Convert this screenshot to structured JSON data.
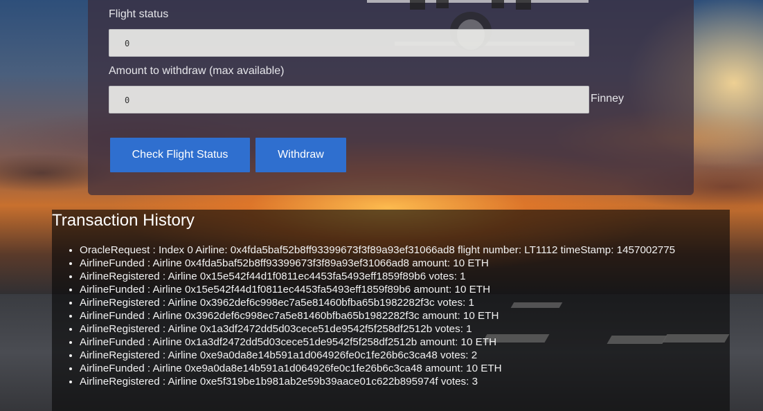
{
  "form": {
    "flight_status_label": "Flight status",
    "flight_status_value": "0",
    "withdraw_label": "Amount to withdraw (max available)",
    "withdraw_value": "0",
    "withdraw_unit": "Finney",
    "check_button_label": "Check Flight Status",
    "withdraw_button_label": "Withdraw"
  },
  "history": {
    "title": "Transaction History",
    "items": [
      "OracleRequest : Index 0 Airline: 0x4fda5baf52b8ff93399673f3f89a93ef31066ad8 flight number: LT1112 timeStamp: 1457002775",
      "AirlineFunded : Airline 0x4fda5baf52b8ff93399673f3f89a93ef31066ad8 amount: 10 ETH",
      "AirlineRegistered : Airline 0x15e542f44d1f0811ec4453fa5493eff1859f89b6 votes: 1",
      "AirlineFunded : Airline 0x15e542f44d1f0811ec4453fa5493eff1859f89b6 amount: 10 ETH",
      "AirlineRegistered : Airline 0x3962def6c998ec7a5e81460bfba65b1982282f3c votes: 1",
      "AirlineFunded : Airline 0x3962def6c998ec7a5e81460bfba65b1982282f3c amount: 10 ETH",
      "AirlineRegistered : Airline 0x1a3df2472dd5d03cece51de9542f5f258df2512b votes: 1",
      "AirlineFunded : Airline 0x1a3df2472dd5d03cece51de9542f5f258df2512b amount: 10 ETH",
      "AirlineRegistered : Airline 0xe9a0da8e14b591a1d064926fe0c1fe26b6c3ca48 votes: 2",
      "AirlineFunded : Airline 0xe9a0da8e14b591a1d064926fe0c1fe26b6c3ca48 amount: 10 ETH",
      "AirlineRegistered : Airline 0xe5f319be1b981ab2e59b39aace01c622b895974f votes: 3"
    ]
  },
  "colors": {
    "button": "#2f6fcf",
    "panel": "#3c2d3c",
    "history_bg": "#080808"
  }
}
